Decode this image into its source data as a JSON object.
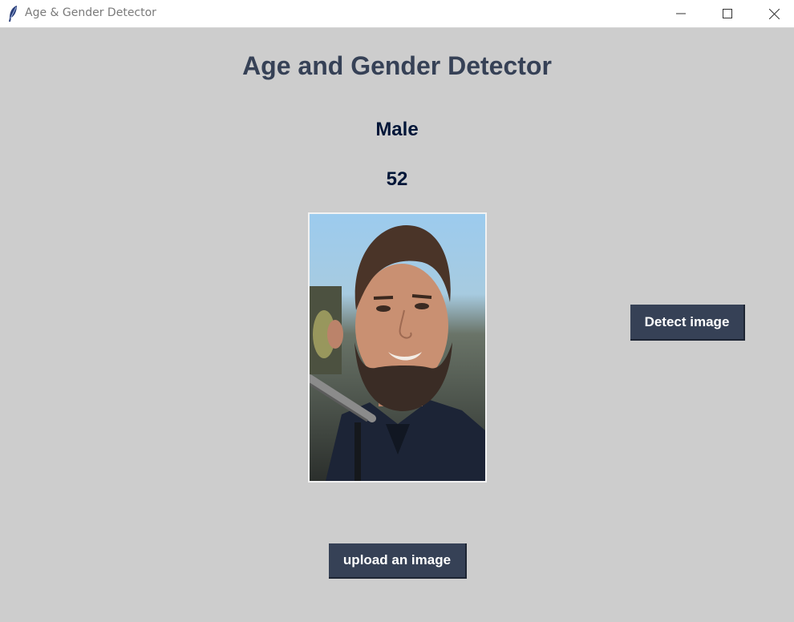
{
  "window": {
    "title": "Age & Gender Detector",
    "icon": "feather-icon",
    "controls": [
      "minimize-icon",
      "maximize-icon",
      "close-icon"
    ]
  },
  "main": {
    "heading": "Age and Gender Detector",
    "gender": "Male",
    "age": "52",
    "image": "uploaded-face-photo"
  },
  "buttons": {
    "detect_label": "Detect image",
    "upload_label": "upload an image"
  },
  "colors": {
    "background": "#cdcdcd",
    "button_bg": "#364156",
    "heading_text": "#364156",
    "result_text": "#011638"
  }
}
